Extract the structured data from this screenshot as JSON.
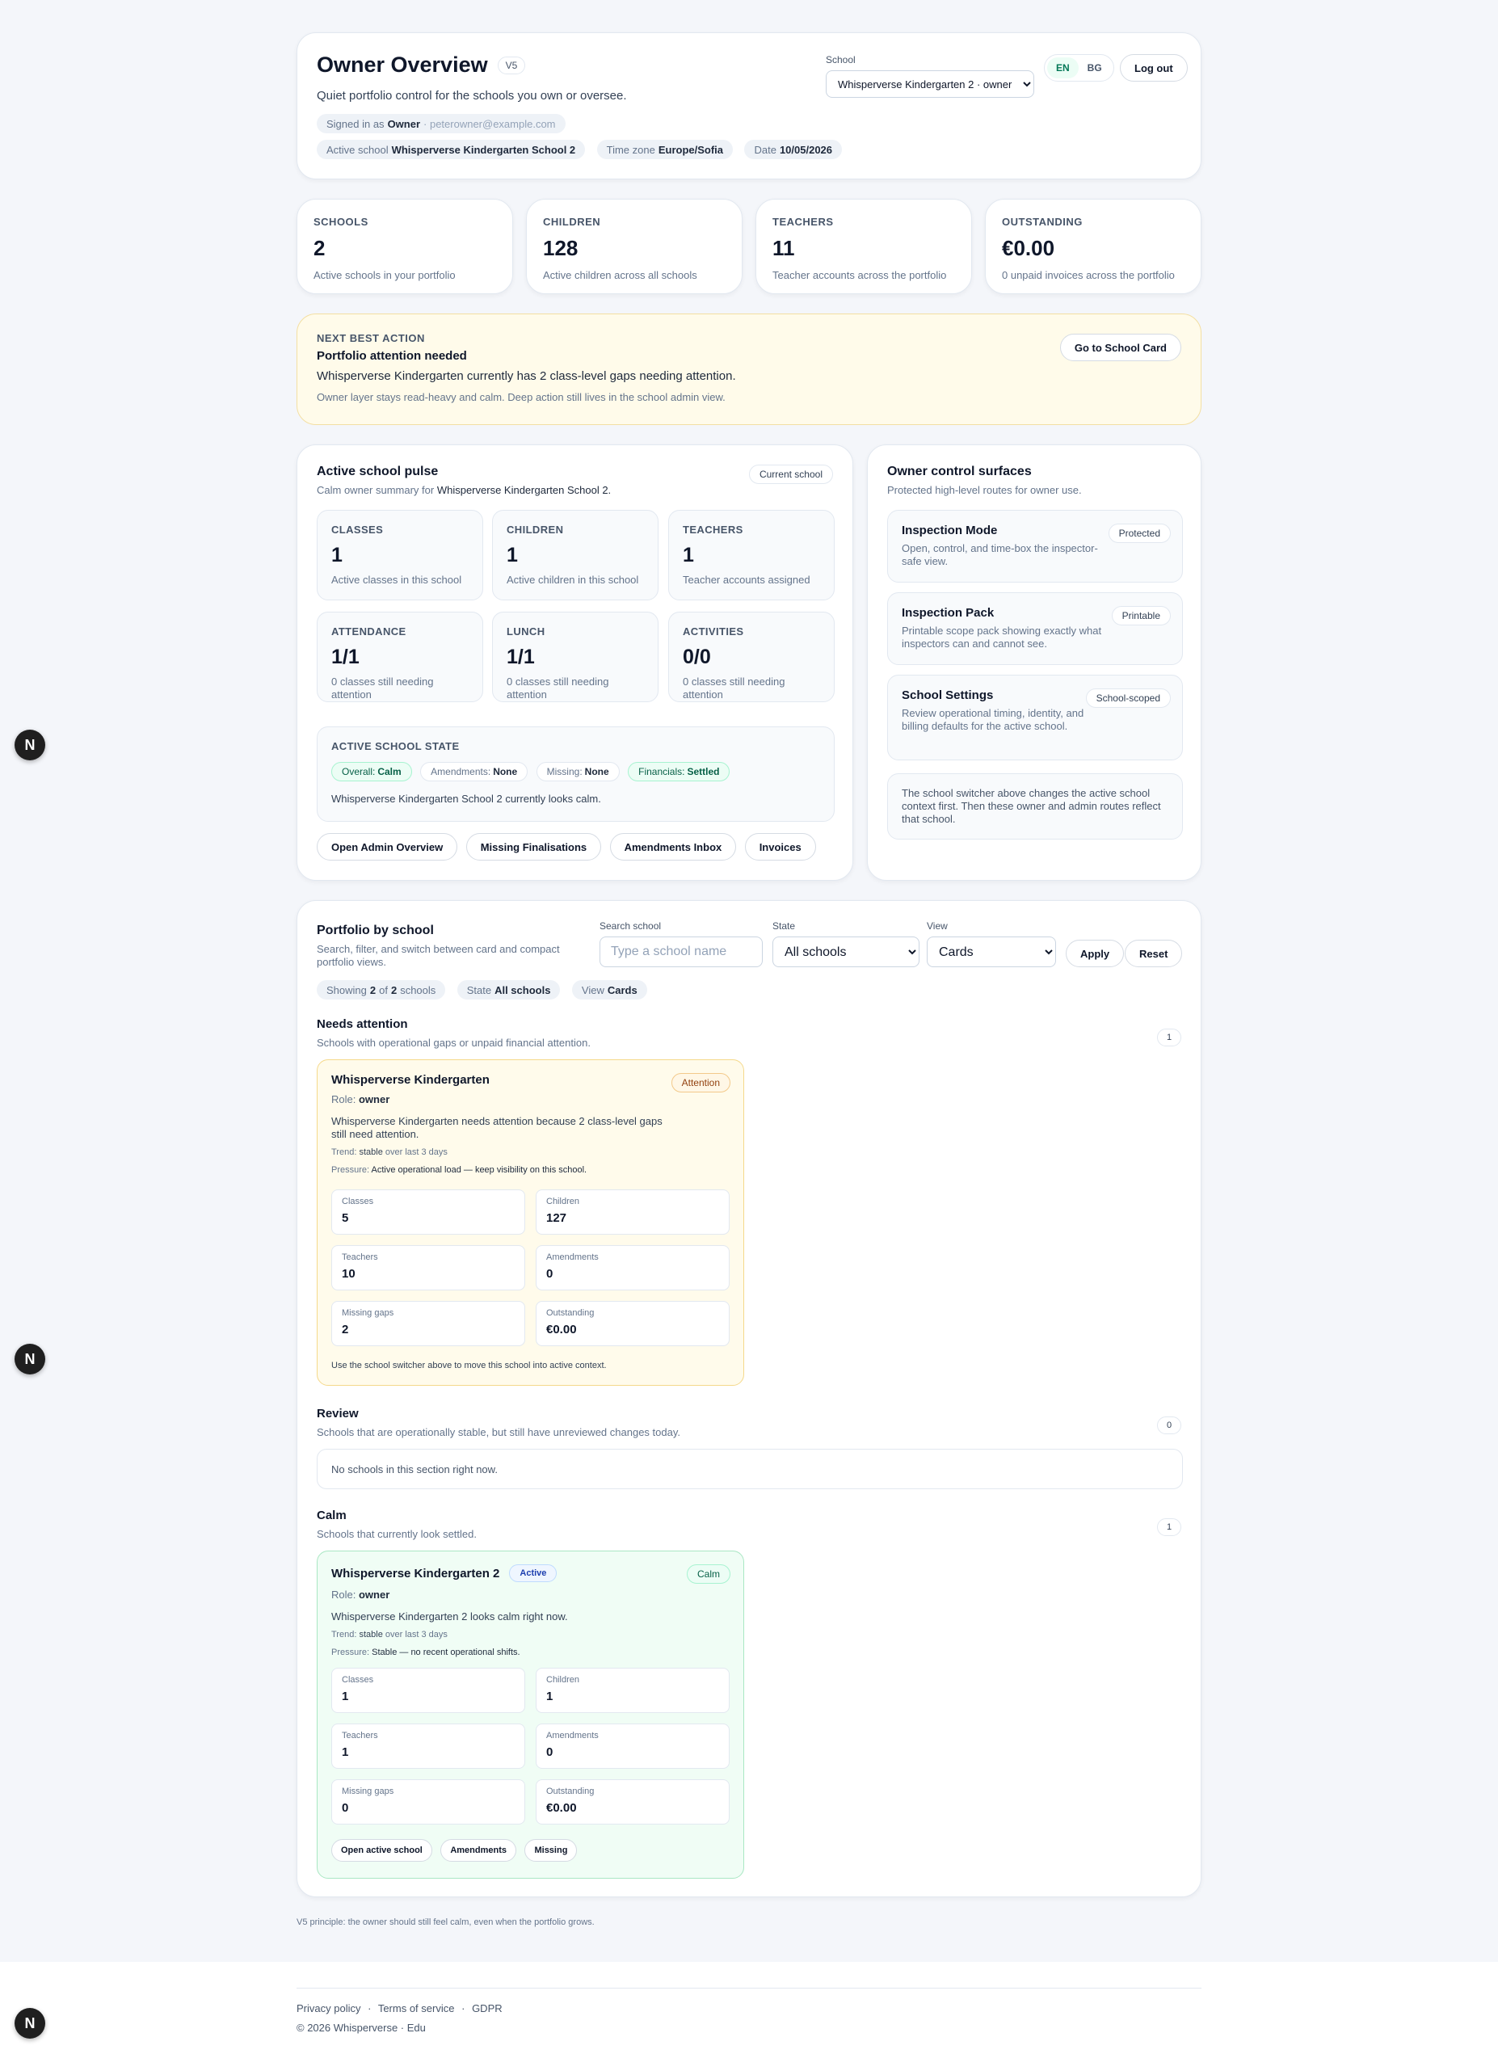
{
  "header": {
    "title": "Owner Overview",
    "version": "V5",
    "subtitle": "Quiet portfolio control for the schools you own or oversee.",
    "signed_in_prefix": "Signed in as",
    "role": "Owner",
    "email": "· peterowner@example.com",
    "active_school_label": "Active school",
    "active_school": "Whisperverse Kindergarten School 2",
    "timezone_label": "Time zone",
    "timezone": "Europe/Sofia",
    "date_label": "Date",
    "date": "10/05/2026",
    "school_label": "School",
    "school_value": "Whisperverse Kindergarten 2 · owner",
    "lang_en": "EN",
    "lang_bg": "BG",
    "logout": "Log out"
  },
  "stats": [
    {
      "label": "Schools",
      "value": "2",
      "desc": "Active schools in your portfolio"
    },
    {
      "label": "Children",
      "value": "128",
      "desc": "Active children across all schools"
    },
    {
      "label": "Teachers",
      "value": "11",
      "desc": "Teacher accounts across the portfolio"
    },
    {
      "label": "Outstanding",
      "value": "€0.00",
      "desc": "0 unpaid invoices across the portfolio"
    }
  ],
  "next_action": {
    "kicker": "NEXT BEST ACTION",
    "title": "Portfolio attention needed",
    "message": "Whisperverse Kindergarten currently has 2 class-level gaps needing attention.",
    "note": "Owner layer stays read-heavy and calm. Deep action still lives in the school admin view.",
    "button": "Go to School Card"
  },
  "pulse": {
    "title": "Active school pulse",
    "sub_prefix": "Calm owner summary for",
    "sub_school": "Whisperverse Kindergarten School 2.",
    "badge": "Current school",
    "tiles": [
      {
        "label": "CLASSES",
        "value": "1",
        "desc": "Active classes in this school"
      },
      {
        "label": "CHILDREN",
        "value": "1",
        "desc": "Active children in this school"
      },
      {
        "label": "TEACHERS",
        "value": "1",
        "desc": "Teacher accounts assigned"
      },
      {
        "label": "ATTENDANCE",
        "value": "1/1",
        "desc": "0 classes still needing attention"
      },
      {
        "label": "LUNCH",
        "value": "1/1",
        "desc": "0 classes still needing attention"
      },
      {
        "label": "ACTIVITIES",
        "value": "0/0",
        "desc": "0 classes still needing attention"
      }
    ],
    "state_title": "ACTIVE SCHOOL STATE",
    "state": {
      "overall_label": "Overall:",
      "overall": "Calm",
      "amend_label": "Amendments:",
      "amend": "None",
      "missing_label": "Missing:",
      "missing": "None",
      "fin_label": "Financials:",
      "fin": "Settled"
    },
    "state_msg": "Whisperverse Kindergarten School 2 currently looks calm.",
    "buttons": [
      "Open Admin Overview",
      "Missing Finalisations",
      "Amendments Inbox",
      "Invoices"
    ]
  },
  "owner": {
    "title": "Owner control surfaces",
    "sub": "Protected high-level routes for owner use.",
    "surfaces": [
      {
        "title": "Inspection Mode",
        "desc": "Open, control, and time-box the inspector-safe view.",
        "badge": "Protected"
      },
      {
        "title": "Inspection Pack",
        "desc": "Printable scope pack showing exactly what inspectors can and cannot see.",
        "badge": "Printable"
      },
      {
        "title": "School Settings",
        "desc": "Review operational timing, identity, and billing defaults for the active school.",
        "badge": "School-scoped"
      }
    ],
    "note": "The school switcher above changes the active school context first. Then these owner and admin routes reflect that school."
  },
  "portfolio": {
    "title": "Portfolio by school",
    "sub": "Search, filter, and switch between card and compact portfolio views.",
    "search_label": "Search school",
    "search_placeholder": "Type a school name",
    "state_label": "State",
    "state_value": "All schools",
    "view_label": "View",
    "view_value": "Cards",
    "apply": "Apply",
    "reset": "Reset",
    "showing_prefix": "Showing",
    "showing_n": "2",
    "showing_of": "of",
    "showing_total": "2",
    "showing_suffix": "schools",
    "state_pill_label": "State",
    "state_pill": "All schools",
    "view_pill_label": "View",
    "view_pill": "Cards",
    "groups": {
      "attention": {
        "title": "Needs attention",
        "sub": "Schools with operational gaps or unpaid financial attention.",
        "count": "1"
      },
      "review": {
        "title": "Review",
        "sub": "Schools that are operationally stable, but still have unreviewed changes today.",
        "count": "0",
        "empty": "No schools in this section right now."
      },
      "calm": {
        "title": "Calm",
        "sub": "Schools that currently look settled.",
        "count": "1"
      }
    },
    "school_att": {
      "name": "Whisperverse Kindergarten",
      "badge": "Attention",
      "role_label": "Role:",
      "role": "owner",
      "msg": "Whisperverse Kindergarten needs attention because 2 class-level gaps still need attention.",
      "trend_label": "Trend:",
      "trend": "stable",
      "trend_suffix": "over last 3 days",
      "pressure_label": "Pressure:",
      "pressure": "Active operational load — keep visibility on this school.",
      "cells": [
        {
          "label": "Classes",
          "value": "5"
        },
        {
          "label": "Children",
          "value": "127"
        },
        {
          "label": "Teachers",
          "value": "10"
        },
        {
          "label": "Amendments",
          "value": "0"
        },
        {
          "label": "Missing gaps",
          "value": "2"
        },
        {
          "label": "Outstanding",
          "value": "€0.00"
        }
      ],
      "footnote": "Use the school switcher above to move this school into active context."
    },
    "school_calm": {
      "name": "Whisperverse Kindergarten 2",
      "active_badge": "Active",
      "badge": "Calm",
      "role_label": "Role:",
      "role": "owner",
      "msg": "Whisperverse Kindergarten 2 looks calm right now.",
      "trend_label": "Trend:",
      "trend": "stable",
      "trend_suffix": "over last 3 days",
      "pressure_label": "Pressure:",
      "pressure": "Stable — no recent operational shifts.",
      "cells": [
        {
          "label": "Classes",
          "value": "1"
        },
        {
          "label": "Children",
          "value": "1"
        },
        {
          "label": "Teachers",
          "value": "1"
        },
        {
          "label": "Amendments",
          "value": "0"
        },
        {
          "label": "Missing gaps",
          "value": "0"
        },
        {
          "label": "Outstanding",
          "value": "€0.00"
        }
      ],
      "buttons": [
        "Open active school",
        "Amendments",
        "Missing"
      ]
    }
  },
  "principle": "V5 principle: the owner should still feel calm, even when the portfolio grows.",
  "footer": {
    "privacy": "Privacy policy",
    "terms": "Terms of service",
    "gdpr": "GDPR",
    "sep": "·",
    "copyright": "© 2026 Whisperverse · Edu"
  },
  "floating_icon": "N"
}
